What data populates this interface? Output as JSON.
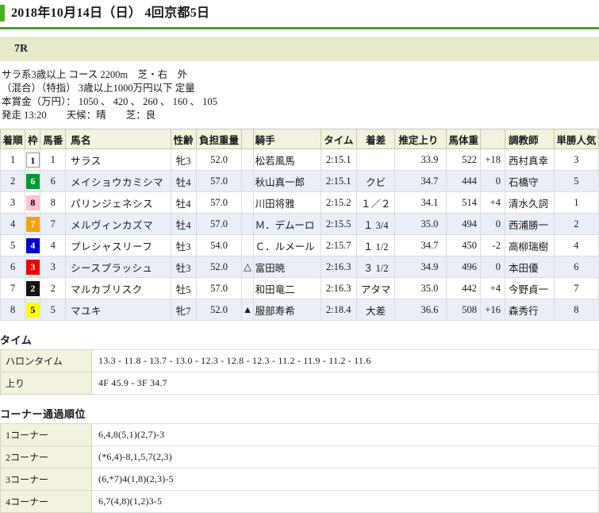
{
  "header": {
    "title": "2018年10月14日（日） 4回京都5日",
    "accent_color": "#4caf2a"
  },
  "race": {
    "number_label": "7R",
    "condition_line1": "サラ系3歳以上 コース 2200m　芝・右　外",
    "condition_line2": "（混合）（特指） 3歳以上1000万円以下 定量",
    "condition_line3": "本賞金（万円）： 1050 、 420 、 260 、 160 、 105",
    "condition_line4": "発走 13:20　　天候：晴　　芝：良"
  },
  "results_table": {
    "headers": [
      "着順",
      "枠",
      "馬番",
      "馬名",
      "性齢",
      "負担重量",
      "",
      "騎手",
      "タイム",
      "着差",
      "推定上り",
      "馬体重",
      "",
      "調教師",
      "単勝人気"
    ],
    "rows": [
      {
        "rank": "1",
        "waku": "1",
        "waku_color": "#ffffff",
        "waku_text_color": "#000000",
        "umaban": "1",
        "name": "サラス",
        "sex_age": "牝3",
        "weight": "52.0",
        "mark": "",
        "jockey": "松若風馬",
        "time": "2:15.1",
        "margin": "",
        "last3f": "33.9",
        "body_weight": "522",
        "body_diff": "+18",
        "trainer": "西村真幸",
        "popularity": "3"
      },
      {
        "rank": "2",
        "waku": "6",
        "waku_color": "#009933",
        "waku_text_color": "#ffffff",
        "umaban": "6",
        "name": "メイショウカミシマ",
        "sex_age": "牡4",
        "weight": "57.0",
        "mark": "",
        "jockey": "秋山真一郎",
        "time": "2:15.1",
        "margin": "クビ",
        "last3f": "34.7",
        "body_weight": "444",
        "body_diff": "0",
        "trainer": "石橋守",
        "popularity": "5"
      },
      {
        "rank": "3",
        "waku": "8",
        "waku_color": "#ffc0cb",
        "waku_text_color": "#000000",
        "umaban": "8",
        "name": "パリンジェネシス",
        "sex_age": "牡4",
        "weight": "57.0",
        "mark": "",
        "jockey": "川田将雅",
        "time": "2:15.2",
        "margin": "１／２",
        "last3f": "34.1",
        "body_weight": "514",
        "body_diff": "+4",
        "trainer": "清水久詞",
        "popularity": "1"
      },
      {
        "rank": "4",
        "waku": "7",
        "waku_color": "#f5a209",
        "waku_text_color": "#ffffff",
        "umaban": "7",
        "name": "メルヴィンカズマ",
        "sex_age": "牡4",
        "weight": "57.0",
        "mark": "",
        "jockey": "Ｍ．デムーロ",
        "time": "2:15.5",
        "margin": "１ 3/4",
        "last3f": "35.0",
        "body_weight": "494",
        "body_diff": "0",
        "trainer": "西浦勝一",
        "popularity": "2"
      },
      {
        "rank": "5",
        "waku": "4",
        "waku_color": "#0000cc",
        "waku_text_color": "#ffffff",
        "umaban": "4",
        "name": "プレシャスリーフ",
        "sex_age": "牡3",
        "weight": "54.0",
        "mark": "",
        "jockey": "Ｃ．ルメール",
        "time": "2:15.7",
        "margin": "１ 1/2",
        "last3f": "34.7",
        "body_weight": "450",
        "body_diff": "-2",
        "trainer": "高柳瑞樹",
        "popularity": "4"
      },
      {
        "rank": "6",
        "waku": "3",
        "waku_color": "#ee0000",
        "waku_text_color": "#ffffff",
        "umaban": "3",
        "name": "シースプラッシュ",
        "sex_age": "牡3",
        "weight": "52.0",
        "mark": "△",
        "jockey": "富田暁",
        "time": "2:16.3",
        "margin": "３ 1/2",
        "last3f": "34.9",
        "body_weight": "496",
        "body_diff": "0",
        "trainer": "本田優",
        "popularity": "6"
      },
      {
        "rank": "7",
        "waku": "2",
        "waku_color": "#111111",
        "waku_text_color": "#ffffff",
        "umaban": "2",
        "name": "マルカブリスク",
        "sex_age": "牡5",
        "weight": "57.0",
        "mark": "",
        "jockey": "和田竜二",
        "time": "2:16.3",
        "margin": "アタマ",
        "last3f": "35.0",
        "body_weight": "442",
        "body_diff": "+4",
        "trainer": "今野貞一",
        "popularity": "7"
      },
      {
        "rank": "8",
        "waku": "5",
        "waku_color": "#ffff00",
        "waku_text_color": "#000000",
        "umaban": "5",
        "name": "マユキ",
        "sex_age": "牝7",
        "weight": "52.0",
        "mark": "▲",
        "jockey": "服部寿希",
        "time": "2:18.4",
        "margin": "大差",
        "last3f": "36.6",
        "body_weight": "508",
        "body_diff": "+16",
        "trainer": "森秀行",
        "popularity": "8"
      }
    ]
  },
  "time_section": {
    "title": "タイム",
    "rows": [
      {
        "label": "ハロンタイム",
        "value": "13.3 - 11.8 - 13.7 - 13.0 - 12.3 - 12.8 - 12.3 - 11.2 - 11.9 - 11.2 - 11.6"
      },
      {
        "label": "上り",
        "value": "4F 45.9 - 3F 34.7"
      }
    ]
  },
  "corner_section": {
    "title": "コーナー通過順位",
    "rows": [
      {
        "label": "1コーナー",
        "value": "6,4,8(5,1)(2,7)-3"
      },
      {
        "label": "2コーナー",
        "value": "(*6,4)-8,1,5,7(2,3)"
      },
      {
        "label": "3コーナー",
        "value": "(6,*7)4(1,8)(2,3)-5"
      },
      {
        "label": "4コーナー",
        "value": "6,7(4,8)(1,2)3-5"
      }
    ]
  }
}
